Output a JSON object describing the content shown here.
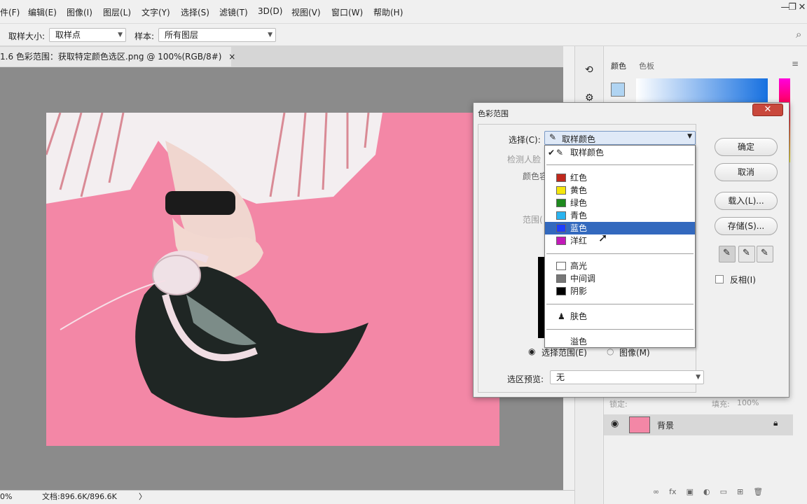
{
  "menubar": {
    "items": [
      "件(F)",
      "编辑(E)",
      "图像(I)",
      "图层(L)",
      "文字(Y)",
      "选择(S)",
      "滤镜(T)",
      "3D(D)",
      "视图(V)",
      "窗口(W)",
      "帮助(H)"
    ],
    "minimize": "—",
    "maximize": "❐",
    "close": "✕"
  },
  "options": {
    "sample_size_label": "取样大小:",
    "sample_size_value": "取样点",
    "sample_label": "样本:",
    "sample_value": "所有图层"
  },
  "document": {
    "tab_title": "1.6 色彩范围：获取特定颜色选区.png @ 100%(RGB/8#)",
    "tab_close": "×"
  },
  "status": {
    "zoom": "0%",
    "doc_info": "文档:896.6K/896.6K",
    "arrow": "〉"
  },
  "panel": {
    "tab_color": "颜色",
    "tab_swatches": "色板",
    "layer_lock_label": "锁定:",
    "fill_label": "填充:",
    "fill_value": "100%",
    "layer_name": "背景"
  },
  "dialog": {
    "title": "色彩范围",
    "close": "✕",
    "select_label": "选择(C):",
    "select_value": "取样颜色",
    "detect_faces": "检测人脸",
    "fuzziness_label": "颜色容差",
    "range_label": "范围(",
    "radio_selection": "选择范围(E)",
    "radio_image": "图像(M)",
    "preview_label": "选区预览:",
    "preview_value": "无",
    "ok": "确定",
    "cancel": "取消",
    "load": "载入(L)...",
    "save": "存储(S)...",
    "invert": "反相(I)"
  },
  "dropdown": {
    "sampled": "取样颜色",
    "colors": [
      {
        "label": "红色",
        "color": "#c0281c"
      },
      {
        "label": "黄色",
        "color": "#f5e60c"
      },
      {
        "label": "绿色",
        "color": "#1f8a1f"
      },
      {
        "label": "青色",
        "color": "#2ab4f0"
      },
      {
        "label": "蓝色",
        "color": "#1e3fff"
      },
      {
        "label": "洋红",
        "color": "#c21ab8"
      }
    ],
    "tones": [
      {
        "label": "高光",
        "color": "#ffffff"
      },
      {
        "label": "中间调",
        "color": "#777777"
      },
      {
        "label": "阴影",
        "color": "#000000"
      }
    ],
    "skin": "肤色",
    "out_of_gamut": "溢色",
    "highlighted": "蓝色"
  }
}
